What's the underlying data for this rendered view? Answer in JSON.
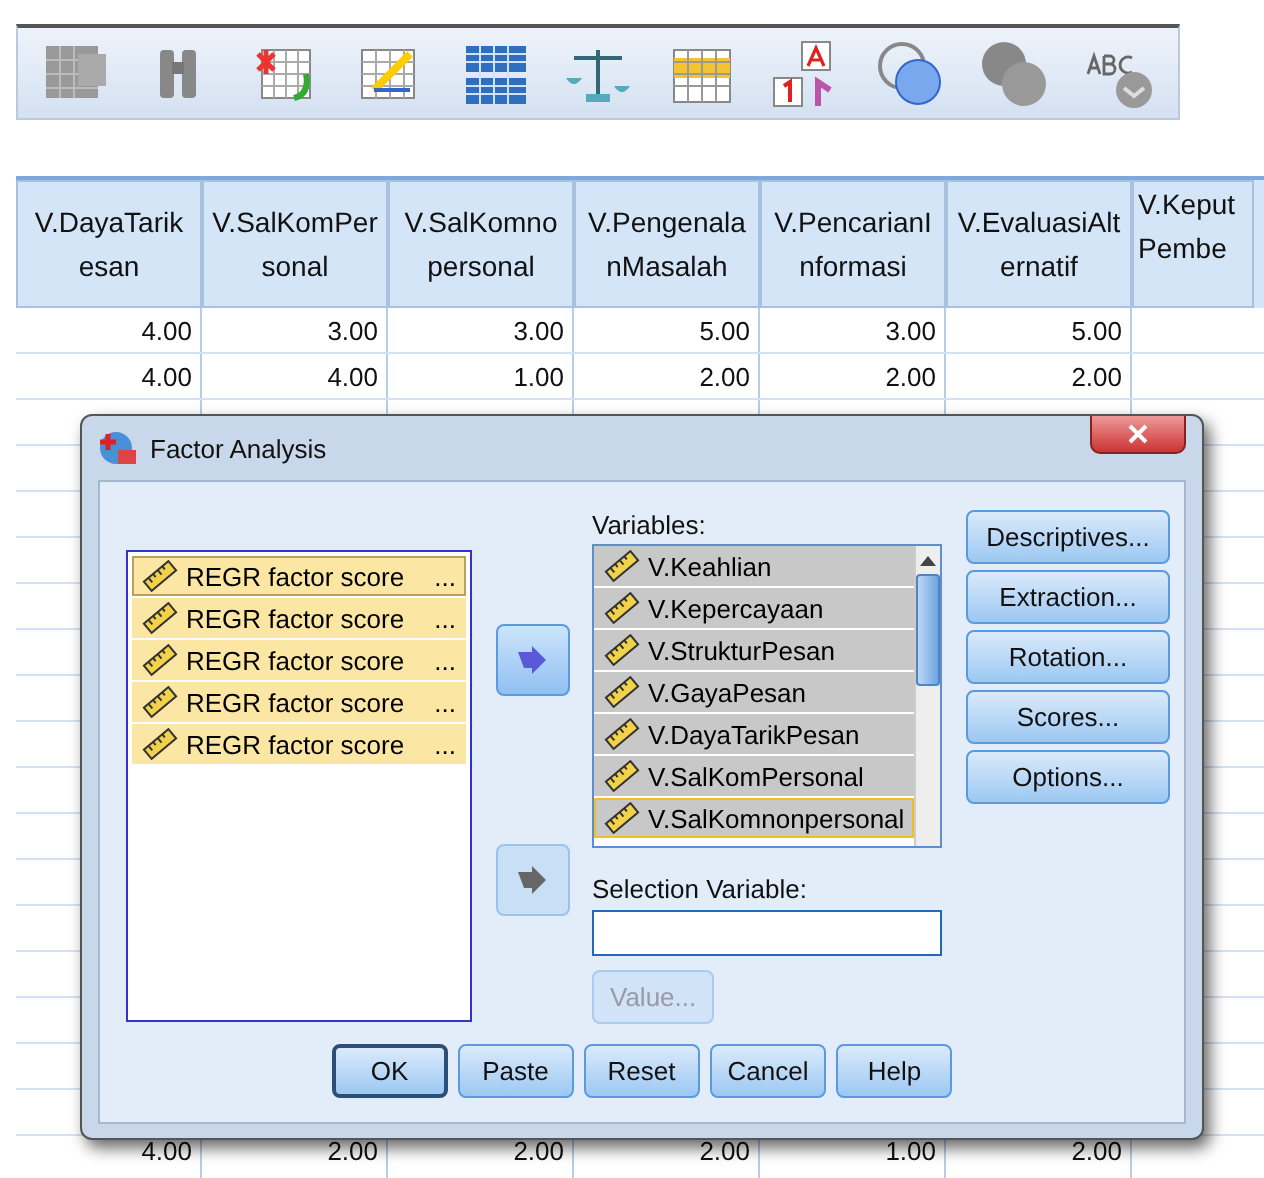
{
  "table": {
    "columns": [
      {
        "top": "V.DayaTarik",
        "bottom": "esan"
      },
      {
        "top": "V.SalKomPer",
        "bottom": "sonal"
      },
      {
        "top": "V.SalKomno",
        "bottom": "personal"
      },
      {
        "top": "V.Pengenala",
        "bottom": "nMasalah"
      },
      {
        "top": "V.PencarianI",
        "bottom": "nformasi"
      },
      {
        "top": "V.EvaluasiAlt",
        "bottom": "ernatif"
      },
      {
        "top": "V.Keput",
        "bottom": "Pembe"
      }
    ],
    "rows": [
      [
        "4.00",
        "3.00",
        "3.00",
        "5.00",
        "3.00",
        "5.00"
      ],
      [
        "4.00",
        "4.00",
        "1.00",
        "2.00",
        "2.00",
        "2.00"
      ]
    ],
    "last_row": [
      "4.00",
      "2.00",
      "2.00",
      "2.00",
      "1.00",
      "2.00"
    ]
  },
  "dialog": {
    "title": "Factor Analysis",
    "source_list": [
      {
        "label": "REGR factor score",
        "more": "...",
        "selected": true,
        "focused": true
      },
      {
        "label": "REGR factor score",
        "more": "...",
        "selected": true,
        "focused": false
      },
      {
        "label": "REGR factor score",
        "more": "...",
        "selected": true,
        "focused": false
      },
      {
        "label": "REGR factor score",
        "more": "...",
        "selected": true,
        "focused": false
      },
      {
        "label": "REGR factor score",
        "more": "...",
        "selected": true,
        "focused": false
      }
    ],
    "variables_label": "Variables:",
    "variables": [
      {
        "label": "V.Keahlian",
        "selected": true,
        "focused": false
      },
      {
        "label": "V.Kepercayaan",
        "selected": true,
        "focused": false
      },
      {
        "label": "V.StrukturPesan",
        "selected": true,
        "focused": false
      },
      {
        "label": "V.GayaPesan",
        "selected": true,
        "focused": false
      },
      {
        "label": "V.DayaTarikPesan",
        "selected": true,
        "focused": false
      },
      {
        "label": "V.SalKomPersonal",
        "selected": true,
        "focused": false
      },
      {
        "label": "V.SalKomnonpersonal",
        "selected": true,
        "focused": true
      }
    ],
    "selection_label": "Selection Variable:",
    "value_button": {
      "label": "Value...",
      "disabled": true
    },
    "side_buttons": [
      "Descriptives...",
      "Extraction...",
      "Rotation...",
      "Scores...",
      "Options..."
    ],
    "bottom_buttons": [
      {
        "label": "OK",
        "default": true
      },
      {
        "label": "Paste",
        "default": false
      },
      {
        "label": "Reset",
        "default": false
      },
      {
        "label": "Cancel",
        "default": false
      },
      {
        "label": "Help",
        "default": false
      }
    ]
  }
}
